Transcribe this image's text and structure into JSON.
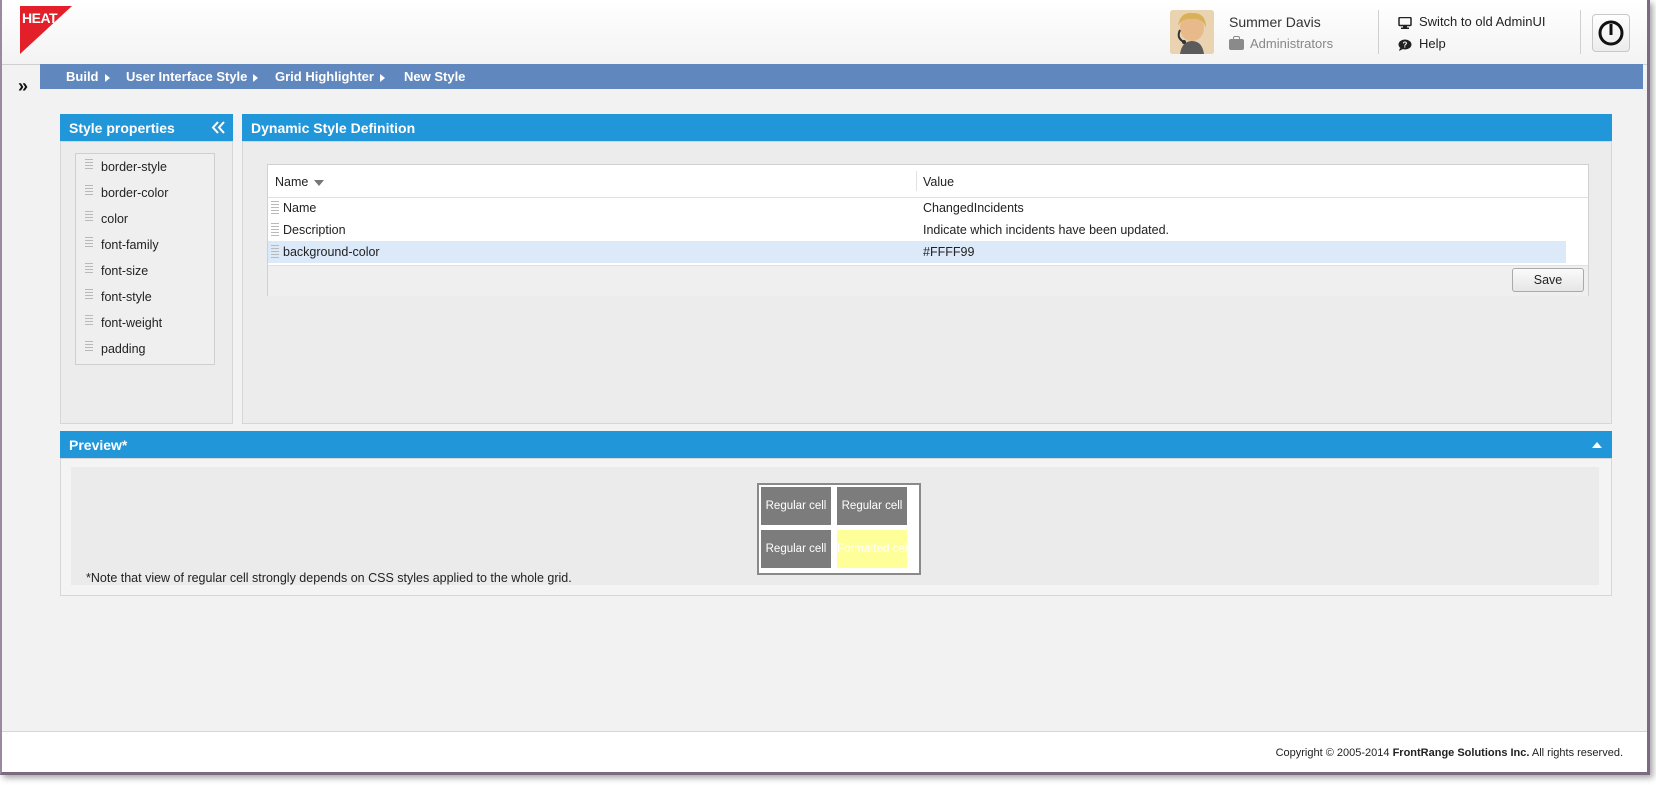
{
  "app": {
    "logo_text": "HEAT",
    "brand_color": "#e3202a"
  },
  "user": {
    "name": "Summer Davis",
    "role": "Administrators"
  },
  "header_links": {
    "switch_label": "Switch to old AdminUI",
    "help_label": "Help"
  },
  "breadcrumb": {
    "items": [
      "Build",
      "User Interface Style",
      "Grid Highlighter",
      "New Style"
    ]
  },
  "style_properties": {
    "title": "Style properties",
    "items": [
      "border-style",
      "border-color",
      "color",
      "font-family",
      "font-size",
      "font-style",
      "font-weight",
      "padding"
    ]
  },
  "definition": {
    "title": "Dynamic Style Definition",
    "columns": [
      "Name",
      "Value"
    ],
    "rows": [
      {
        "name": "Name",
        "value": "ChangedIncidents"
      },
      {
        "name": "Description",
        "value": "Indicate which incidents have been updated."
      },
      {
        "name": "background-color",
        "value": "#FFFF99"
      }
    ],
    "selected_row": 2,
    "save_label": "Save"
  },
  "preview": {
    "title": "Preview*",
    "cells": [
      "Regular cell",
      "Regular cell",
      "Regular cell",
      "Formatted cell"
    ],
    "highlight_color": "#FFFF99",
    "note": "*Note that view of regular cell strongly depends on CSS styles applied to the whole grid."
  },
  "footer": {
    "copyright_prefix": "Copyright © 2005-2014",
    "company": "FrontRange Solutions Inc.",
    "suffix": "All rights reserved."
  },
  "colors": {
    "panel_header": "#2196d9",
    "breadcrumb_bar": "#6088bf",
    "selected_row": "#dbe9f9"
  }
}
